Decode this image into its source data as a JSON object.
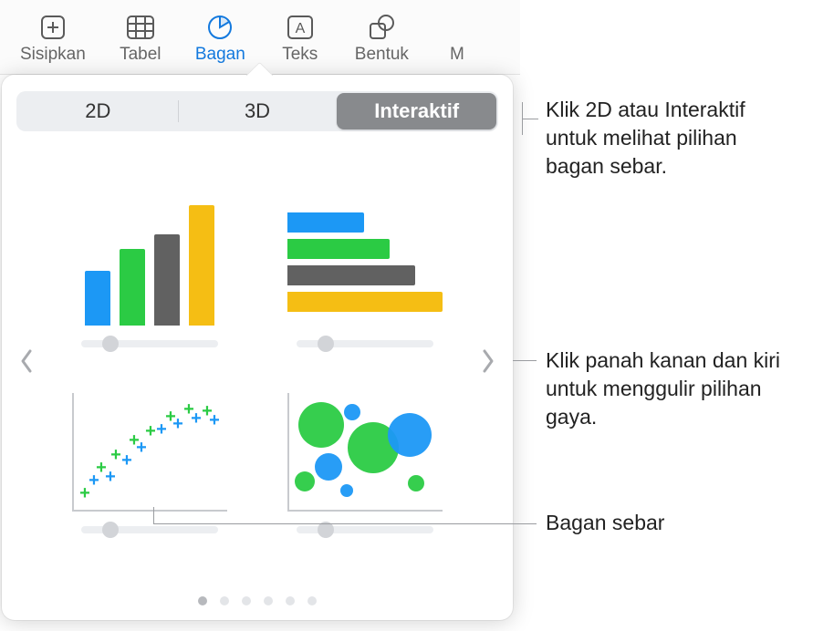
{
  "toolbar": {
    "items": [
      {
        "label": "Sisipkan",
        "icon": "plus-box-icon"
      },
      {
        "label": "Tabel",
        "icon": "table-icon"
      },
      {
        "label": "Bagan",
        "icon": "pie-chart-icon",
        "active": true
      },
      {
        "label": "Teks",
        "icon": "text-box-icon"
      },
      {
        "label": "Bentuk",
        "icon": "shape-icon"
      },
      {
        "label": "M",
        "icon": "more-icon"
      }
    ]
  },
  "segmented": {
    "tab_2d": "2D",
    "tab_3d": "3D",
    "tab_interactive": "Interaktif",
    "selected": "Interaktif"
  },
  "charts": [
    {
      "name": "interactive-column-chart"
    },
    {
      "name": "interactive-bar-chart"
    },
    {
      "name": "interactive-scatter-chart"
    },
    {
      "name": "interactive-bubble-chart"
    }
  ],
  "pagination": {
    "count": 6,
    "active_index": 0
  },
  "annotations": {
    "a1": "Klik 2D atau Interaktif untuk melihat pilihan bagan sebar.",
    "a2": "Klik panah kanan dan kiri untuk menggulir pilihan gaya.",
    "a3": "Bagan sebar"
  }
}
